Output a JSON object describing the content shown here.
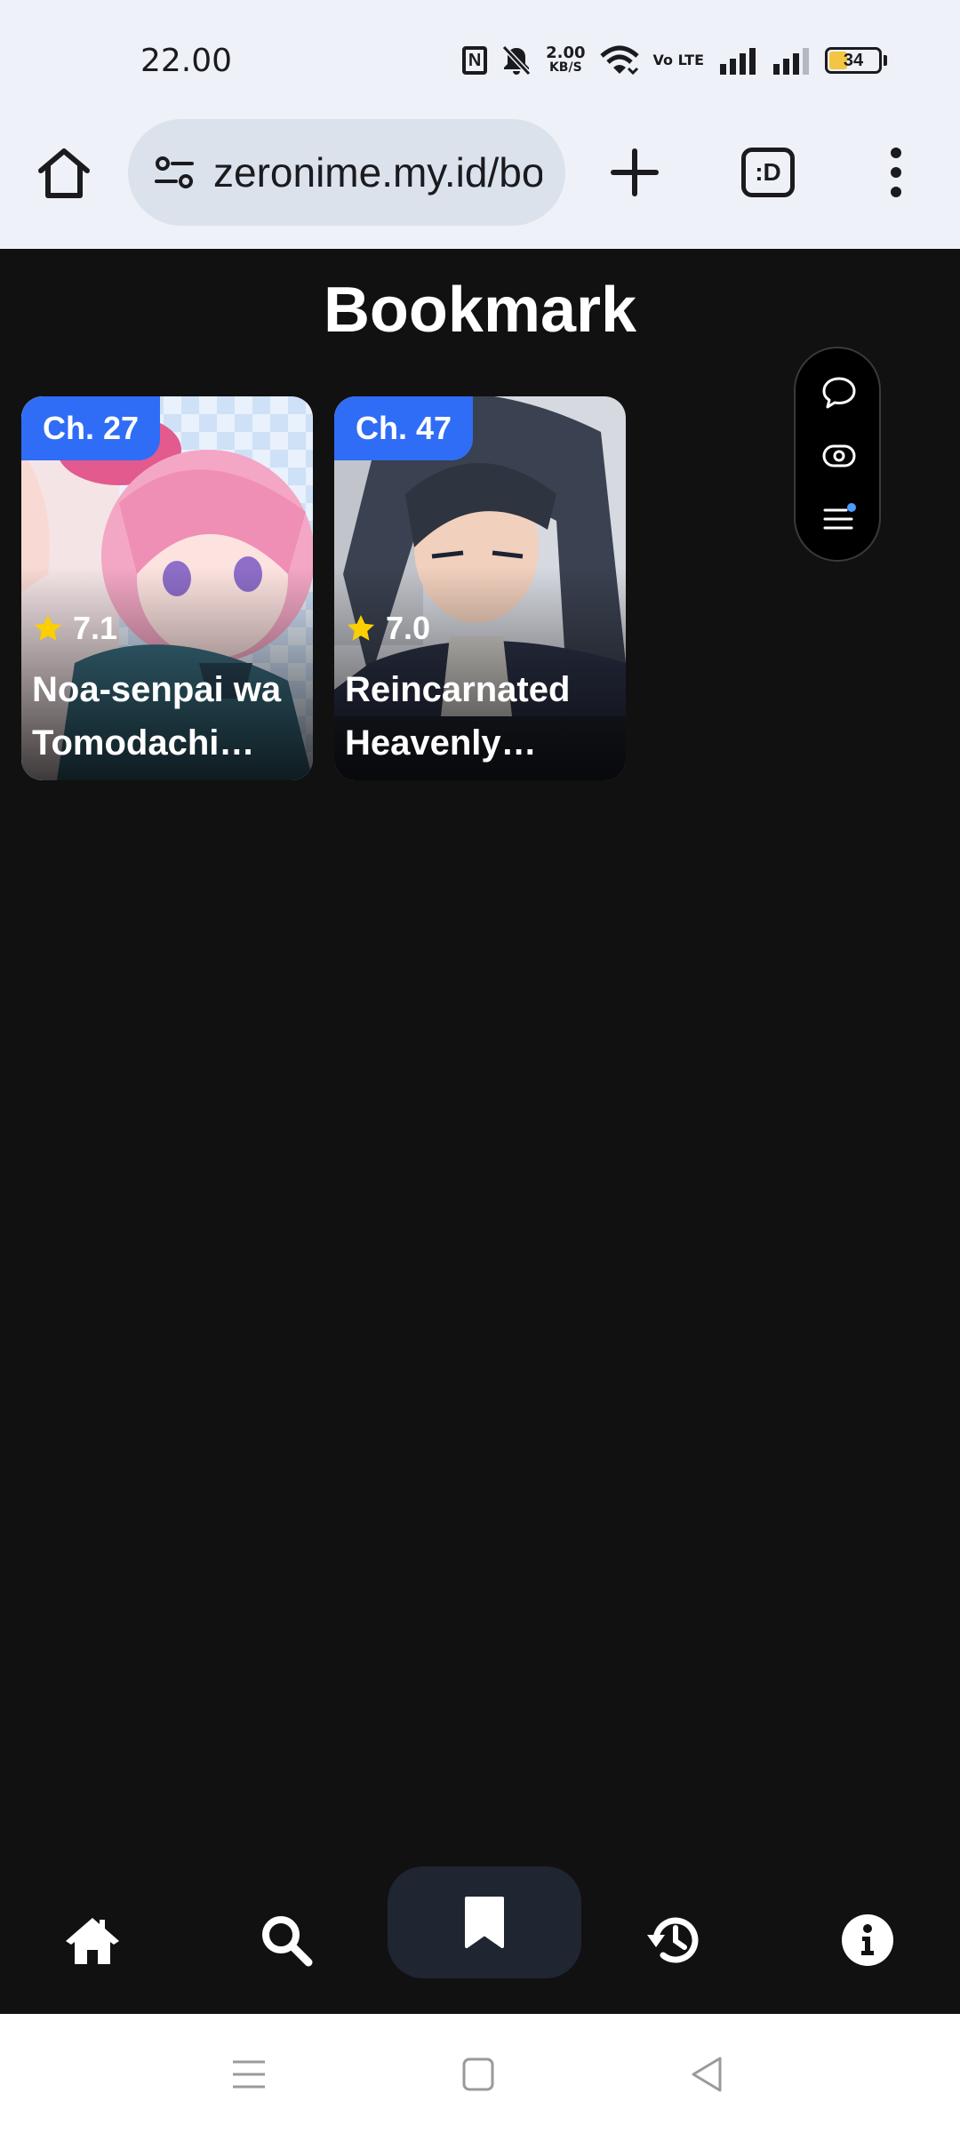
{
  "status_bar": {
    "time": "22.00",
    "speed_value": "2.00",
    "speed_unit": "KB/S",
    "volte": "Vo LTE",
    "battery": "34",
    "battery_level": 0.34
  },
  "browser": {
    "url": "zeronime.my.id/bookmark",
    "tabs_label": ":D"
  },
  "page": {
    "title": "Bookmark"
  },
  "bookmarks": [
    {
      "chapter": "Ch. 27",
      "rating": "7.1",
      "title": "Noa-senpai wa Tomodachi…"
    },
    {
      "chapter": "Ch. 47",
      "rating": "7.0",
      "title": "Reincarnated Heavenly…"
    }
  ],
  "colors": {
    "accent": "#2f6df6",
    "background": "#111111",
    "star": "#fbd000",
    "nav_active": "#1f2531",
    "float_dot": "#4b9dff"
  },
  "nav": {
    "items": [
      "home-icon",
      "search-icon",
      "bookmark-icon",
      "history-icon",
      "info-icon"
    ],
    "active": "bookmark-icon"
  }
}
